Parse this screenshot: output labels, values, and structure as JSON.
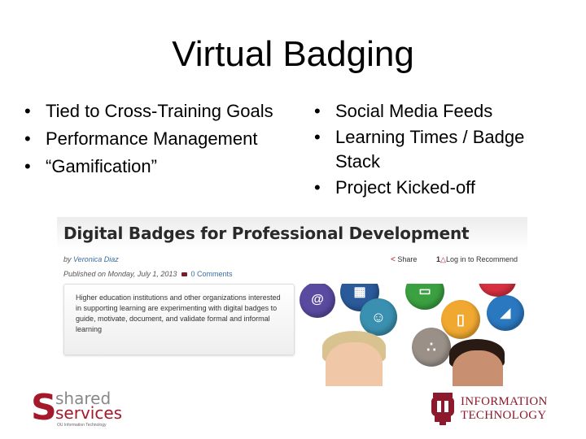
{
  "slide": {
    "title": "Virtual Badging",
    "left_bullets": [
      "Tied to Cross-Training Goals",
      "Performance Management",
      "“Gamification”"
    ],
    "right_bullets": [
      "Social Media Feeds",
      "Learning Times / Badge Stack",
      "Project Kicked-off"
    ],
    "bullet_glyph": "•"
  },
  "article": {
    "title": "Digital Badges for Professional Development",
    "by_prefix": "by ",
    "author": "Veronica Diaz",
    "published": "Published on Monday, July 1, 2013",
    "comments": "0 Comments",
    "share_icon": "share-icon",
    "share_glyph": "<",
    "share_label": "Share",
    "recommend_count": "1",
    "thumb_glyph": "△",
    "recommend_label": "Log in to Recommend",
    "summary": "Higher education institutions and other organizations interested in supporting learning are experimenting with digital badges to guide, motivate, document, and validate formal and informal learning",
    "image_badges": [
      {
        "name": "email-badge",
        "glyph": "@",
        "color": "#5a4aa0"
      },
      {
        "name": "video-badge",
        "glyph": "▦",
        "color": "#2a5a9a"
      },
      {
        "name": "people-badge",
        "glyph": "☺",
        "color": "#3a90b0"
      },
      {
        "name": "chat-badge",
        "glyph": "▭",
        "color": "#3aa040"
      },
      {
        "name": "share-badge",
        "glyph": "∴",
        "color": "#9a9088"
      },
      {
        "name": "phone-badge",
        "glyph": "▯",
        "color": "#f0a830"
      },
      {
        "name": "rss-badge",
        "glyph": "◢",
        "color": "#2a78c0"
      },
      {
        "name": "red-badge",
        "glyph": "✓",
        "color": "#d83040"
      }
    ]
  },
  "logos": {
    "shared_s": "S",
    "shared": "shared",
    "services": "services",
    "shared_sub": "OU Information Technology",
    "ou_line1": "INFORMATION",
    "ou_line2": "TECHNOLOGY"
  },
  "colors": {
    "ou_crimson": "#8c1a2c",
    "link_blue": "#3a6ea5"
  }
}
